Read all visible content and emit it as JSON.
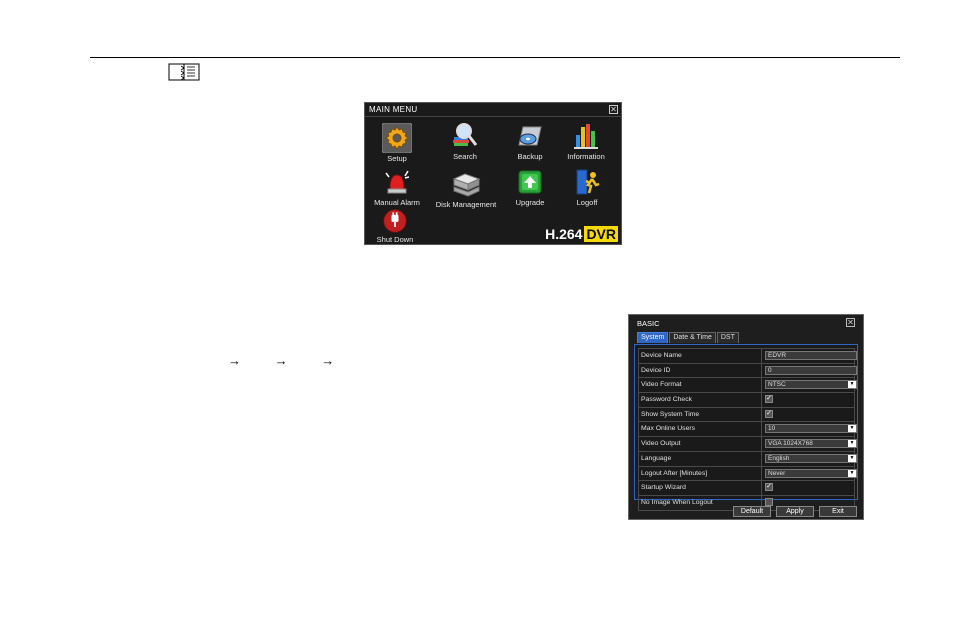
{
  "page": {
    "arrows": [
      "→",
      "→",
      "→"
    ]
  },
  "main_menu": {
    "title": "MAIN MENU",
    "close": "✕",
    "items": [
      {
        "label": "Setup",
        "icon": "gear-icon"
      },
      {
        "label": "Search",
        "icon": "magnifier-icon"
      },
      {
        "label": "Backup",
        "icon": "disc-backup-icon"
      },
      {
        "label": "Information",
        "icon": "bar-chart-icon"
      },
      {
        "label": "Manual Alarm",
        "icon": "alarm-siren-icon"
      },
      {
        "label": "Disk Management",
        "icon": "hard-disk-icon"
      },
      {
        "label": "Upgrade",
        "icon": "upgrade-arrow-icon"
      },
      {
        "label": "Logoff",
        "icon": "logoff-person-icon"
      },
      {
        "label": "Shut Down",
        "icon": "power-plug-icon"
      }
    ],
    "brand_h264": "H.264",
    "brand_dvr": "DVR"
  },
  "basic": {
    "title": "BASIC",
    "close": "✕",
    "tabs": [
      "System",
      "Date & Time",
      "DST"
    ],
    "rows": [
      {
        "label": "Device Name",
        "value": "EDVR"
      },
      {
        "label": "Device ID",
        "value": "0"
      },
      {
        "label": "Video Format",
        "value": "NTSC"
      },
      {
        "label": "Password Check",
        "checked": true
      },
      {
        "label": "Show System Time",
        "checked": true
      },
      {
        "label": "Max Online Users",
        "value": "10"
      },
      {
        "label": "Video Output",
        "value": "VGA 1024X768"
      },
      {
        "label": "Language",
        "value": "English"
      },
      {
        "label": "Logout After [Minutes]",
        "value": "Never"
      },
      {
        "label": "Startup Wizard",
        "checked": true
      },
      {
        "label": "No Image When Logout",
        "checked": false
      }
    ],
    "buttons": {
      "default": "Default",
      "apply": "Apply",
      "exit": "Exit"
    },
    "check_mark": "✓",
    "dropdown_arrow": "▼"
  }
}
